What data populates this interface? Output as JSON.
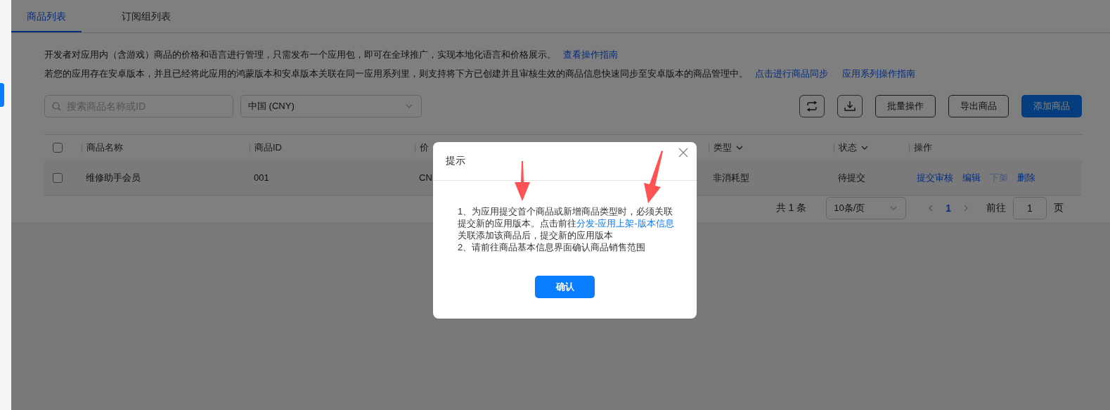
{
  "tabs": [
    {
      "label": "商品列表",
      "selected": true
    },
    {
      "label": "订阅组列表",
      "selected": false
    }
  ],
  "notice": [
    {
      "text": "开发者对应用内（含游戏）商品的价格和语言进行管理，只需发布一个应用包，即可在全球推广，实现本地化语言和价格展示。",
      "links": [
        "查看操作指南"
      ]
    },
    {
      "text": "若您的应用存在安卓版本，并且已经将此应用的鸿蒙版本和安卓版本关联在同一应用系列里，则支持将下方已创建并且审核生效的商品信息快速同步至安卓版本的商品管理中。",
      "links": [
        "点击进行商品同步",
        "应用系列操作指南"
      ]
    }
  ],
  "toolbar": {
    "search": {
      "placeholder": "搜索商品名称或ID"
    },
    "region_select": {
      "value": "中国 (CNY)"
    },
    "buttons": [
      {
        "kind": "icon"
      },
      {
        "kind": "icon"
      },
      {
        "kind": "outline",
        "label": "批量操作"
      },
      {
        "kind": "outline",
        "label": "导出商品"
      },
      {
        "kind": "primary",
        "label": "添加商品"
      }
    ]
  },
  "table": {
    "header_checked": false,
    "columns": [
      {
        "label": "商品名称",
        "kind": "plain"
      },
      {
        "label": "商品ID",
        "kind": "plain"
      },
      {
        "label": "价",
        "kind": "plain"
      },
      {
        "label": "类型",
        "kind": "filter"
      },
      {
        "label": "状态",
        "kind": "filter"
      },
      {
        "label": "操作",
        "kind": "plain"
      }
    ],
    "rows": [
      {
        "checked": false,
        "cells": [
          "维修助手会员",
          "001",
          "CN",
          "非消耗型",
          "待提交"
        ],
        "actions": [
          {
            "label": "提交审核",
            "disabled": false
          },
          {
            "label": "编辑",
            "disabled": false
          },
          {
            "label": "下架",
            "disabled": true
          },
          {
            "label": "删除",
            "disabled": false
          }
        ]
      }
    ]
  },
  "pagination": {
    "total": "共 1 条",
    "page_size": "10条/页",
    "pages": [
      {
        "label": "1",
        "selected": true
      }
    ],
    "goto_label": "前往",
    "goto_value": "1",
    "goto_suffix": "页"
  },
  "dialog": {
    "title": "提示",
    "paragraphs": [
      {
        "before": "1、为应用提交首个商品或新增商品类型时，必须关联提交新的应用版本。点击前往",
        "link": "分发-应用上架-版本信息",
        "after": "关联添加该商品后，提交新的应用版本"
      },
      {
        "before": "2、请前往商品基本信息界面确认商品销售范围"
      }
    ],
    "confirm": "确认"
  }
}
